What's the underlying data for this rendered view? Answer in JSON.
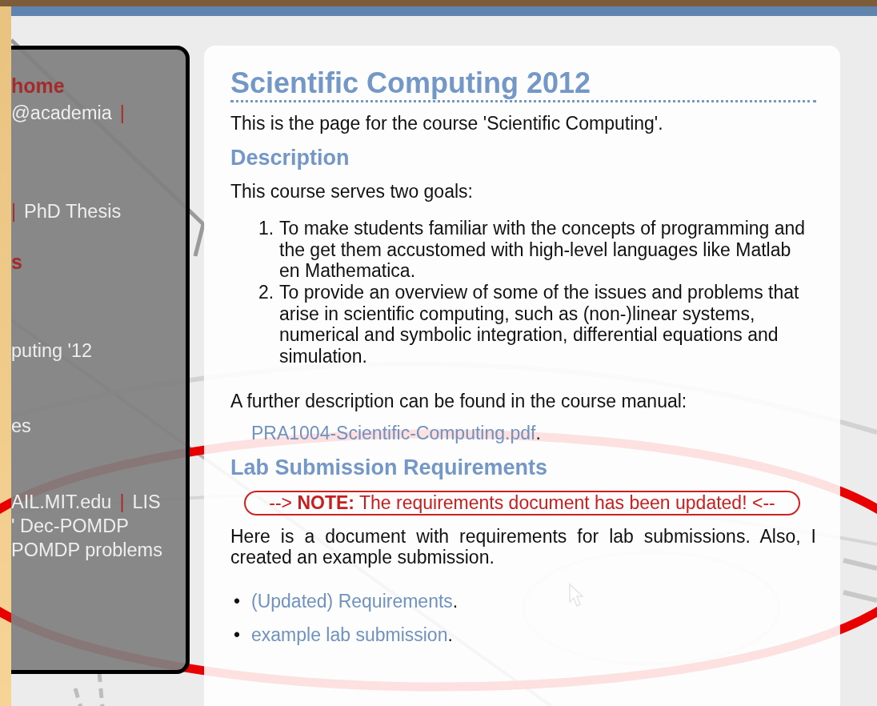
{
  "sidebar": {
    "lines": [
      {
        "parts": [
          {
            "kind": "heading",
            "text": "home"
          }
        ]
      },
      {
        "parts": [
          {
            "kind": "link",
            "text": "@academia"
          },
          {
            "kind": "separator",
            "text": "|"
          }
        ]
      },
      {
        "parts": [
          {
            "kind": "separator",
            "text": "|"
          },
          {
            "kind": "link",
            "text": "PhD Thesis"
          }
        ]
      },
      {
        "parts": [
          {
            "kind": "heading",
            "text": "s"
          }
        ]
      },
      {
        "parts": [
          {
            "kind": "link",
            "text": "puting '12"
          }
        ]
      },
      {
        "parts": [
          {
            "kind": "link",
            "text": "es"
          }
        ]
      },
      {
        "parts": [
          {
            "kind": "link",
            "text": "AIL.MIT.edu"
          },
          {
            "kind": "separator",
            "text": "|"
          },
          {
            "kind": "link",
            "text": "LIS"
          }
        ]
      },
      {
        "parts": [
          {
            "kind": "link",
            "text": "' Dec-POMDP"
          }
        ]
      },
      {
        "parts": [
          {
            "kind": "link",
            "text": "POMDP problems"
          }
        ]
      }
    ]
  },
  "content": {
    "title": "Scientific Computing 2012",
    "blocks": [
      {
        "kind": "paragraph",
        "text": "This is the page for the course 'Scientific Computing'."
      },
      {
        "kind": "heading",
        "text": "Description"
      },
      {
        "kind": "paragraph",
        "text": "This course serves two goals:"
      },
      {
        "kind": "ordered_list",
        "items": [
          {
            "marker": "1.",
            "text": "To make students familiar with the concepts of programming and the get them accustomed with high-level languages like Matlab en Mathematica."
          },
          {
            "marker": "2.",
            "text": "To provide an overview of some of the issues and problems that arise in scientific computing, such as (non-)linear systems, numerical and symbolic integration, differential equations and simulation."
          }
        ]
      },
      {
        "kind": "paragraph",
        "text": "A further description can be found in the course manual:"
      },
      {
        "kind": "link_line",
        "link": "PRA1004-Scientific-Computing.pdf",
        "after": "."
      },
      {
        "kind": "heading",
        "text": "Lab Submission Requirements"
      },
      {
        "kind": "note",
        "text": "--> **NOTE:** The requirements document has been updated! <--"
      },
      {
        "kind": "paragraph",
        "text": "Here is a document with requirements for lab submissions. Also, I created an example submission."
      },
      {
        "kind": "bullet_list",
        "items": [
          {
            "marker": "•",
            "link": "(Updated) Requirements",
            "after": "."
          },
          {
            "marker": "•",
            "link": "example lab submission",
            "after": "."
          }
        ]
      }
    ]
  }
}
